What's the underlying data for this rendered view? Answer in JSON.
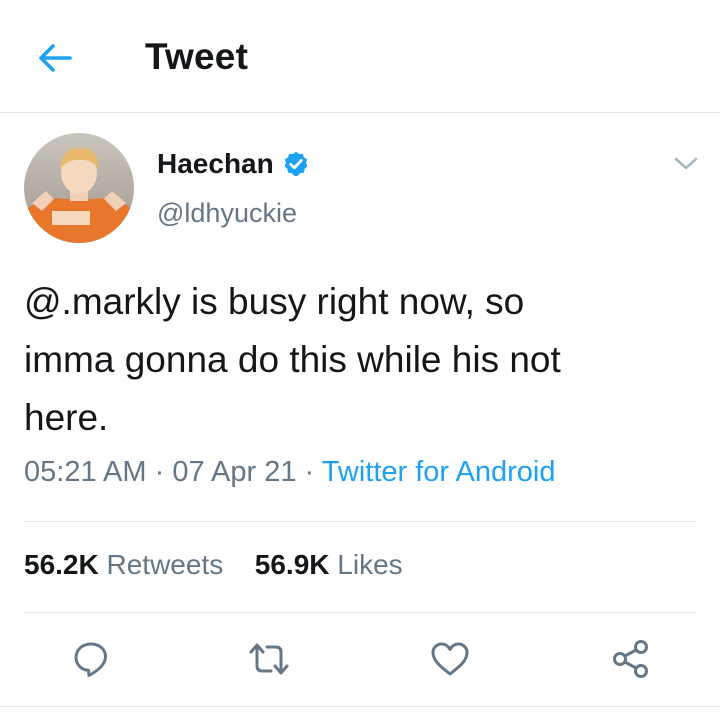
{
  "header": {
    "title": "Tweet",
    "back_icon": "arrow-left-icon",
    "accent_color": "#1da1f2"
  },
  "tweet": {
    "author_name": "Haechan",
    "verified": true,
    "verified_icon": "verified-badge-icon",
    "handle": "@ldhyuckie",
    "avatar": "profile-photo",
    "text": "@.markly is busy right now, so\nimma gonna do this while his not\nhere.",
    "time": "05:21 AM",
    "date": "07 Apr 21",
    "separator": "·",
    "source": "Twitter for Android"
  },
  "stats": {
    "retweets_count": "56.2K",
    "retweets_label": "Retweets",
    "likes_count": "56.9K",
    "likes_label": "Likes"
  },
  "actions": [
    "reply-icon",
    "retweet-icon",
    "like-icon",
    "share-icon"
  ],
  "colors": {
    "text": "#14171a",
    "secondary": "#657786",
    "link": "#1da1f2",
    "divider": "#e1e8ed"
  }
}
